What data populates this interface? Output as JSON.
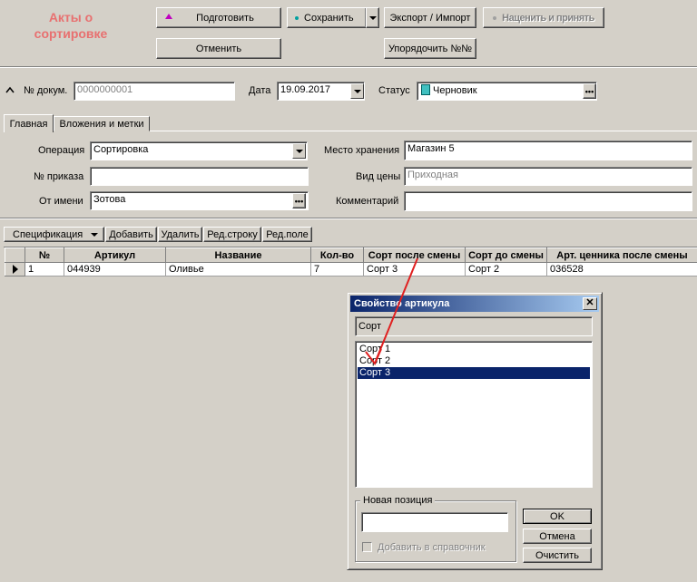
{
  "header": {
    "title_line1": "Акты о",
    "title_line2": "сортировке",
    "title_color": "#e87070",
    "buttons": {
      "prepare": "Подготовить",
      "save": "Сохранить",
      "export_import": "Экспорт / Импорт",
      "price_accept": "Наценить и принять",
      "cancel": "Отменить",
      "sort_numbers": "Упорядочить №№"
    }
  },
  "doc": {
    "number_label": "№ докум.",
    "number_value": "0000000001",
    "date_label": "Дата",
    "date_value": "19.09.2017",
    "status_label": "Статус",
    "status_value": "Черновик"
  },
  "tabs": [
    "Главная",
    "Вложения и метки"
  ],
  "form": {
    "operation_label": "Операция",
    "operation_value": "Сортировка",
    "order_label": "№ приказа",
    "order_value": "",
    "from_label": "От имени",
    "from_value": "Зотова",
    "storage_label": "Место хранения",
    "storage_value": "Магазин 5",
    "price_type_label": "Вид цены",
    "price_type_value": "Приходная",
    "comment_label": "Комментарий",
    "comment_value": ""
  },
  "spec_toolbar": {
    "spec": "Спецификация",
    "add": "Добавить",
    "delete": "Удалить",
    "edit_row": "Ред.строку",
    "edit_field": "Ред.поле"
  },
  "table": {
    "columns": [
      "№",
      "Артикул",
      "Название",
      "Кол-во",
      "Сорт после смены",
      "Сорт до смены",
      "Арт. ценника после смены"
    ],
    "rows": [
      [
        "1",
        "044939",
        "Оливье",
        "7",
        "Сорт 3",
        "Сорт 2",
        "036528"
      ]
    ]
  },
  "dialog": {
    "title": "Свойство артикула",
    "header_field": "Сорт",
    "options": [
      "Сорт 1",
      "Сорт 2",
      "Сорт 3"
    ],
    "selected_index": 2,
    "new_position_label": "Новая позиция",
    "new_position_value": "",
    "add_to_dir_label": "Добавить в справочник",
    "ok": "OK",
    "cancel": "Отмена",
    "clear": "Очистить",
    "close_glyph": "✕"
  },
  "colors": {
    "selection": "#0a246a",
    "arrow": "#e02020"
  }
}
